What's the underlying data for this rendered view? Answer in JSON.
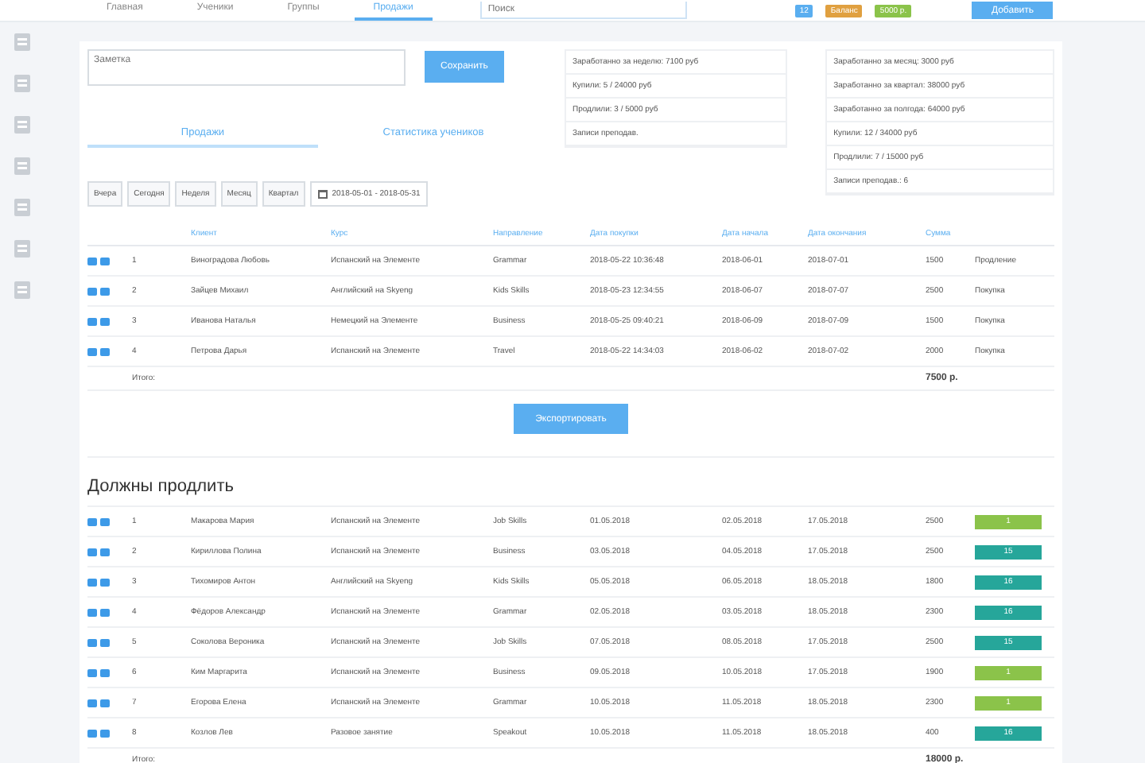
{
  "top_nav": {
    "tabs": [
      {
        "label": "Главная",
        "selected": false
      },
      {
        "label": "Ученики",
        "selected": false
      },
      {
        "label": "Группы",
        "selected": false
      },
      {
        "label": "Продажи",
        "selected": true
      }
    ],
    "search": {
      "placeholder": "Поиск"
    },
    "badges": [
      {
        "text": "12",
        "color": "#5aaef0"
      },
      {
        "text": "Баланс",
        "color": "#e0a040"
      },
      {
        "text": "5000 р.",
        "color": "#8bc34a"
      }
    ],
    "button": "Добавить"
  },
  "sidebar": {
    "items": [
      {
        "selected": false
      },
      {
        "selected": false
      },
      {
        "selected": false
      },
      {
        "selected": false
      },
      {
        "selected": false
      },
      {
        "selected": false
      },
      {
        "selected": false
      }
    ]
  },
  "note": {
    "placeholder": "Заметка",
    "button": "Сохранить"
  },
  "view_tabs": [
    {
      "label": "Продажи",
      "selected": true
    },
    {
      "label": "Статистика учеников",
      "selected": false
    }
  ],
  "stats_left": [
    "Заработанно за неделю: 7100 руб",
    "Купили: 5 / 24000 руб",
    "Продлили: 3 / 5000 руб",
    "Записи преподав."
  ],
  "stats_right": [
    "Заработанно за месяц: 3000 руб",
    "Заработанно за квартал: 38000 руб",
    "Заработанно за полгода: 64000 руб",
    "Купили: 12 / 34000 руб",
    "Продлили: 7 / 15000 руб",
    "Записи преподав.: 6"
  ],
  "filters": {
    "buttons": [
      "Вчера",
      "Сегодня",
      "Неделя",
      "Месяц",
      "Квартал"
    ],
    "date_range": "2018-05-01 - 2018-05-31"
  },
  "sales_table": {
    "columns": [
      "Клиент",
      "Курс",
      "Направление",
      "Дата покупки",
      "Дата начала",
      "Дата окончания",
      "Сумма"
    ],
    "rows": [
      {
        "num": "1",
        "client": "Виноградова Любовь",
        "course": "Испанский на Элементе",
        "direction": "Grammar",
        "purchase": "2018-05-22 10:36:48",
        "start": "2018-06-01",
        "end": "2018-07-01",
        "sum": "1500",
        "status": "Продление"
      },
      {
        "num": "2",
        "client": "Зайцев Михаил",
        "course": "Английский на Skyeng",
        "direction": "Kids Skills",
        "purchase": "2018-05-23 12:34:55",
        "start": "2018-06-07",
        "end": "2018-07-07",
        "sum": "2500",
        "status": "Покупка"
      },
      {
        "num": "3",
        "client": "Иванова Наталья",
        "course": "Немецкий на Элементе",
        "direction": "Business",
        "purchase": "2018-05-25 09:40:21",
        "start": "2018-06-09",
        "end": "2018-07-09",
        "sum": "1500",
        "status": "Покупка"
      },
      {
        "num": "4",
        "client": "Петрова Дарья",
        "course": "Испанский на Элементе",
        "direction": "Travel",
        "purchase": "2018-05-22 14:34:03",
        "start": "2018-06-02",
        "end": "2018-07-02",
        "sum": "2000",
        "status": "Покупка"
      }
    ],
    "total_label": "Итого:",
    "total": "7500 р."
  },
  "export_button": "Экспортировать",
  "renew": {
    "title": "Должны продлить",
    "rows": [
      {
        "num": "1",
        "client": "Макарова Мария",
        "course": "Испанский на Элементе",
        "direction": "Job Skills",
        "purchase": "01.05.2018",
        "start": "02.05.2018",
        "end": "17.05.2018",
        "sum": "2500",
        "badge": "1",
        "color": "#8bc34a"
      },
      {
        "num": "2",
        "client": "Кириллова Полина",
        "course": "Испанский на Элементе",
        "direction": "Business",
        "purchase": "03.05.2018",
        "start": "04.05.2018",
        "end": "17.05.2018",
        "sum": "2500",
        "badge": "15",
        "color": "#26a69a"
      },
      {
        "num": "3",
        "client": "Тихомиров Антон",
        "course": "Английский на Skyeng",
        "direction": "Kids Skills",
        "purchase": "05.05.2018",
        "start": "06.05.2018",
        "end": "18.05.2018",
        "sum": "1800",
        "badge": "16",
        "color": "#26a69a"
      },
      {
        "num": "4",
        "client": "Фёдоров Александр",
        "course": "Испанский на Элементе",
        "direction": "Grammar",
        "purchase": "02.05.2018",
        "start": "03.05.2018",
        "end": "18.05.2018",
        "sum": "2300",
        "badge": "16",
        "color": "#26a69a"
      },
      {
        "num": "5",
        "client": "Соколова Вероника",
        "course": "Испанский на Элементе",
        "direction": "Job Skills",
        "purchase": "07.05.2018",
        "start": "08.05.2018",
        "end": "17.05.2018",
        "sum": "2500",
        "badge": "15",
        "color": "#26a69a"
      },
      {
        "num": "6",
        "client": "Ким Маргарита",
        "course": "Испанский на Элементе",
        "direction": "Business",
        "purchase": "09.05.2018",
        "start": "10.05.2018",
        "end": "17.05.2018",
        "sum": "1900",
        "badge": "1",
        "color": "#8bc34a"
      },
      {
        "num": "7",
        "client": "Егорова Елена",
        "course": "Испанский на Элементе",
        "direction": "Grammar",
        "purchase": "10.05.2018",
        "start": "11.05.2018",
        "end": "18.05.2018",
        "sum": "2300",
        "badge": "1",
        "color": "#8bc34a"
      },
      {
        "num": "8",
        "client": "Козлов Лев",
        "course": "Разовое занятие",
        "direction": "Speakout",
        "purchase": "10.05.2018",
        "start": "11.05.2018",
        "end": "18.05.2018",
        "sum": "400",
        "badge": "16",
        "color": "#26a69a"
      }
    ],
    "total_label": "Итого:",
    "total": "18000 р."
  }
}
